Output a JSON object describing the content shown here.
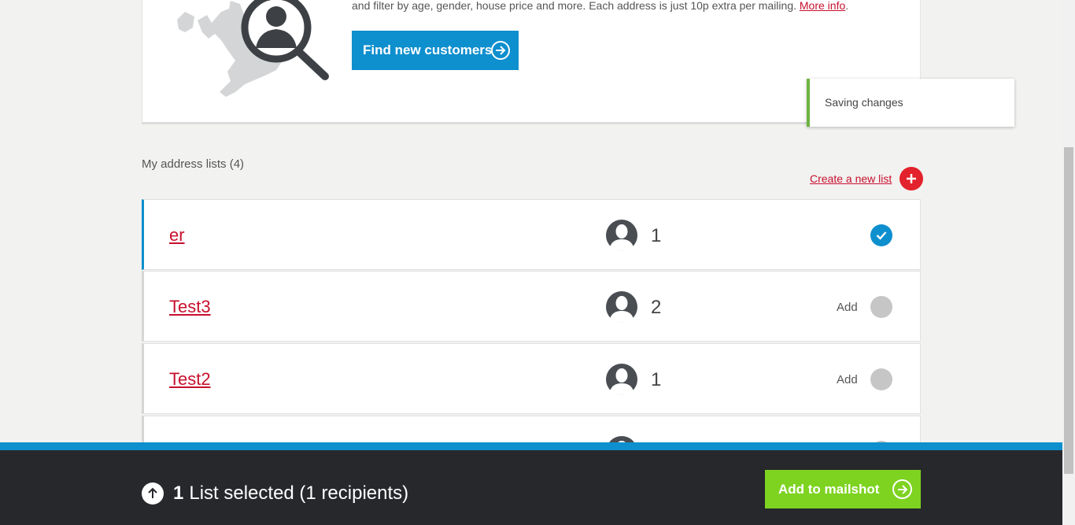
{
  "promo": {
    "text": "and filter by age, gender, house price and more. Each address is just 10p extra per mailing.",
    "more_info_link": "More info",
    "period": ".",
    "find_button_label": "Find new customers"
  },
  "toast": {
    "message": "Saving changes",
    "accent_color": "#6cb33f"
  },
  "lists": {
    "heading": "My address lists (4)",
    "create_link": "Create a new list",
    "add_label": "Add",
    "rows": [
      {
        "name": "er",
        "count": "1",
        "selected": true
      },
      {
        "name": "Test3",
        "count": "2",
        "selected": false
      },
      {
        "name": "Test2",
        "count": "1",
        "selected": false
      }
    ]
  },
  "footer": {
    "selected_count": "1",
    "selected_text": "List selected (1 recipients)",
    "mailshot_button": "Add to mailshot"
  },
  "colors": {
    "brand_blue": "#0e8fce",
    "link_red": "#c8102e",
    "plus_red": "#e2222c",
    "action_green": "#7ed321",
    "footer_dark": "#26282c"
  },
  "icons": [
    "uk-map-magnifier-icon",
    "arrow-right-circle-icon",
    "plus-icon",
    "user-avatar-icon",
    "checkmark-icon",
    "arrow-up-icon"
  ]
}
